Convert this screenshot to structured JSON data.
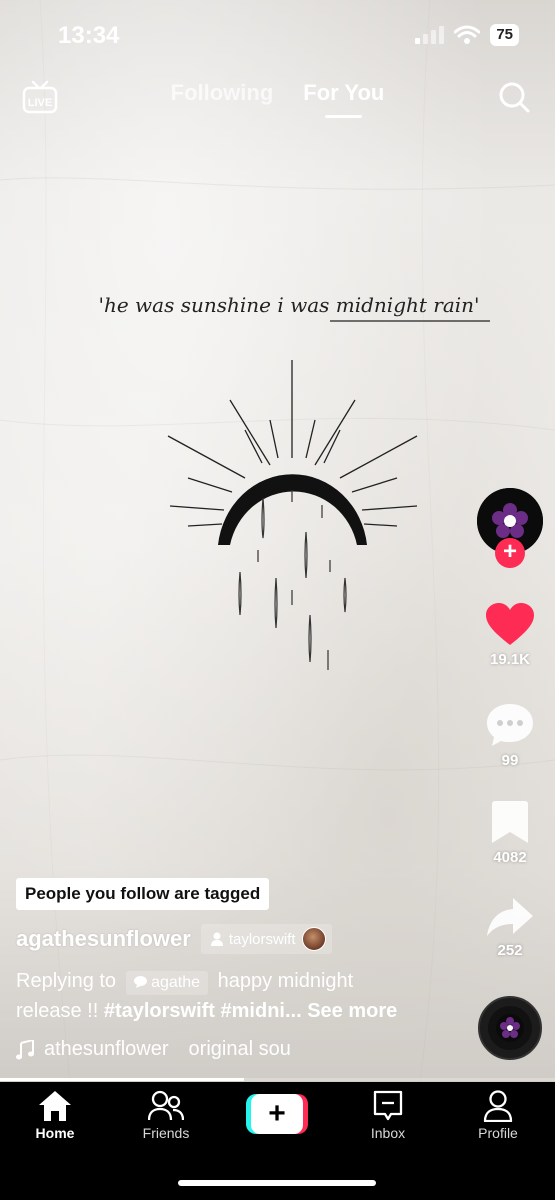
{
  "status_bar": {
    "time": "13:34",
    "battery": "75"
  },
  "top_nav": {
    "tabs": [
      {
        "label": "Following"
      },
      {
        "label": "For You"
      }
    ],
    "live_label": "LIVE"
  },
  "post": {
    "artwork_text": "'he was sunshine i was midnight rain'",
    "tagged_notice": "People you follow are tagged",
    "username": "agathesunflower",
    "tagged_user": "taylorswift",
    "reply_prefix": "Replying to",
    "reply_user": "agathe",
    "caption_line1": "happy midnight",
    "caption_line2": "release !!",
    "hashtags": "#taylorswift #midni...",
    "see_more": "See more",
    "music_author": "athesunflower",
    "music_title": "original sou",
    "progress": 0.44
  },
  "rail": {
    "likes": "19.1K",
    "comments": "99",
    "saves": "4082",
    "shares": "252"
  },
  "tab_bar": {
    "home": "Home",
    "friends": "Friends",
    "inbox": "Inbox",
    "profile": "Profile"
  },
  "colors": {
    "accent_red": "#fe2c55",
    "accent_cyan": "#25f4ee"
  }
}
